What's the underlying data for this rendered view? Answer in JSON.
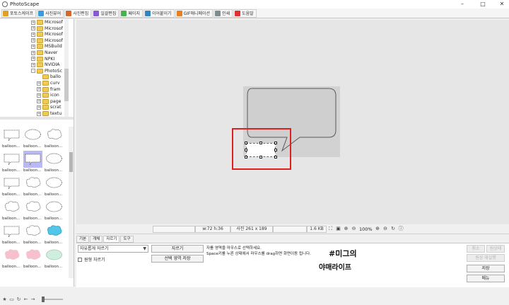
{
  "window": {
    "title": "PhotoScape"
  },
  "tabs": [
    {
      "label": "포토스케이프",
      "color": "#e0a020",
      "active": false
    },
    {
      "label": "사진뷰어",
      "color": "#3b9ad9",
      "active": false
    },
    {
      "label": "사진편집",
      "color": "#d46a2a",
      "active": true
    },
    {
      "label": "일괄편집",
      "color": "#8a5bd0",
      "active": false
    },
    {
      "label": "페이지",
      "color": "#4caf50",
      "active": false
    },
    {
      "label": "이어붙이기",
      "color": "#2e86c1",
      "active": false
    },
    {
      "label": "GIF애니메이션",
      "color": "#e67e22",
      "active": false
    },
    {
      "label": "인쇄",
      "color": "#7f8c8d",
      "active": false
    },
    {
      "label": "도움말",
      "color": "#e03030",
      "active": false
    }
  ],
  "tree": [
    {
      "label": "Microsof",
      "indent": 0,
      "sign": "+"
    },
    {
      "label": "Microsof",
      "indent": 0,
      "sign": "+"
    },
    {
      "label": "Microsof",
      "indent": 0,
      "sign": "+"
    },
    {
      "label": "Microsof",
      "indent": 0,
      "sign": "+"
    },
    {
      "label": "MSBuild",
      "indent": 0,
      "sign": "+"
    },
    {
      "label": "Naver",
      "indent": 0,
      "sign": "+"
    },
    {
      "label": "NPKI",
      "indent": 0,
      "sign": "+"
    },
    {
      "label": "NVIDIA",
      "indent": 0,
      "sign": "+"
    },
    {
      "label": "PhotoSc",
      "indent": 0,
      "sign": "-"
    },
    {
      "label": "ballo",
      "indent": 1,
      "sign": ""
    },
    {
      "label": "curv",
      "indent": 1,
      "sign": "+"
    },
    {
      "label": "fram",
      "indent": 1,
      "sign": "+"
    },
    {
      "label": "icon",
      "indent": 1,
      "sign": "+"
    },
    {
      "label": "page",
      "indent": 1,
      "sign": "+"
    },
    {
      "label": "scrat",
      "indent": 1,
      "sign": "+"
    },
    {
      "label": "textu",
      "indent": 1,
      "sign": "+"
    }
  ],
  "thumbnail_label": "balloon...",
  "status": {
    "size": "w:72 h:36",
    "photo": "사진 261 x 189",
    "filesize": "1.6 KB",
    "zoom": "100%"
  },
  "panel": {
    "tabs": [
      "기본",
      "개체",
      "자르기",
      "도구"
    ],
    "active_tab": "자르기",
    "select_value": "자유롭게 자르기",
    "checkbox_label": "원형 자르기",
    "crop_button": "자르기",
    "save_selection_button": "선택 영역 저장",
    "help_line1": "자를 영역을 마우스로 선택하세요.",
    "help_line2": "Space키를 누른 상태에서 마우스를 drag하면 화면이동 됩니다.",
    "handwriting1": "#미그의",
    "handwriting2": "야매라이프"
  },
  "right_buttons": {
    "undo": "취소",
    "undo_all": "원상태",
    "redo": "원상 재실행",
    "save": "저장",
    "menu": "메뉴"
  }
}
